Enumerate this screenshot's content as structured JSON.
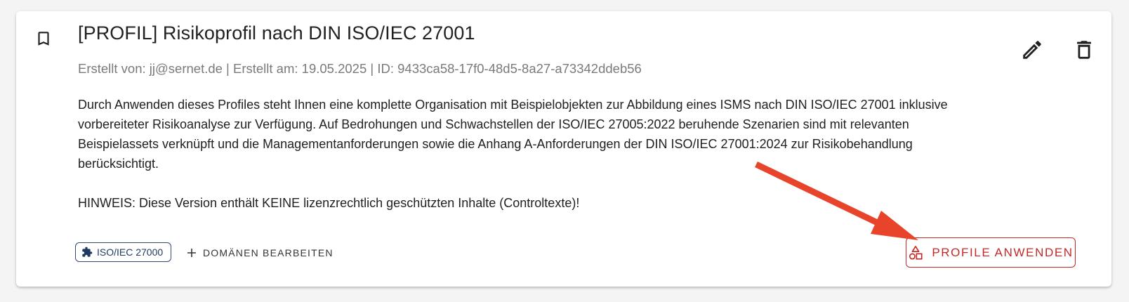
{
  "profile": {
    "title": "[PROFIL] Risikoprofil nach DIN ISO/IEC 27001",
    "meta": "Erstellt von: jj@sernet.de | Erstellt am: 19.05.2025 | ID: 9433ca58-17f0-48d5-8a27-a73342ddeb56",
    "description": "Durch Anwenden dieses Profiles steht Ihnen eine komplette Organisation mit Beispielobjekten zur Abbildung eines ISMS nach DIN ISO/IEC 27001 inklusive vorbereiteter Risikoanalyse zur Verfügung. Auf Bedrohungen und Schwachstellen der ISO/IEC 27005:2022 beruhende Szenarien sind mit relevanten Beispielassets verknüpft und die Managementanforderungen sowie die Anhang A-Anforderungen der DIN ISO/IEC 27001:2024 zur Risikobehandlung berücksichtigt.",
    "hint": "HINWEIS: Diese Version enthält KEINE lizenzrechtlich geschützten Inhalte (Controltexte)!",
    "domain_chip": "ISO/IEC 27000",
    "edit_domains_label": "DOMÄNEN BEARBEITEN",
    "apply_label": "PROFILE ANWENDEN"
  },
  "icons": {
    "bookmark": "bookmark-outline-icon",
    "edit": "pencil-icon",
    "delete": "trash-icon",
    "chip": "puzzle-icon",
    "add": "plus-icon",
    "apply": "shapes-icon"
  },
  "colors": {
    "accent_red": "#c62828",
    "chip_blue": "#1e3a5f",
    "annotation_arrow": "#e8432b"
  }
}
